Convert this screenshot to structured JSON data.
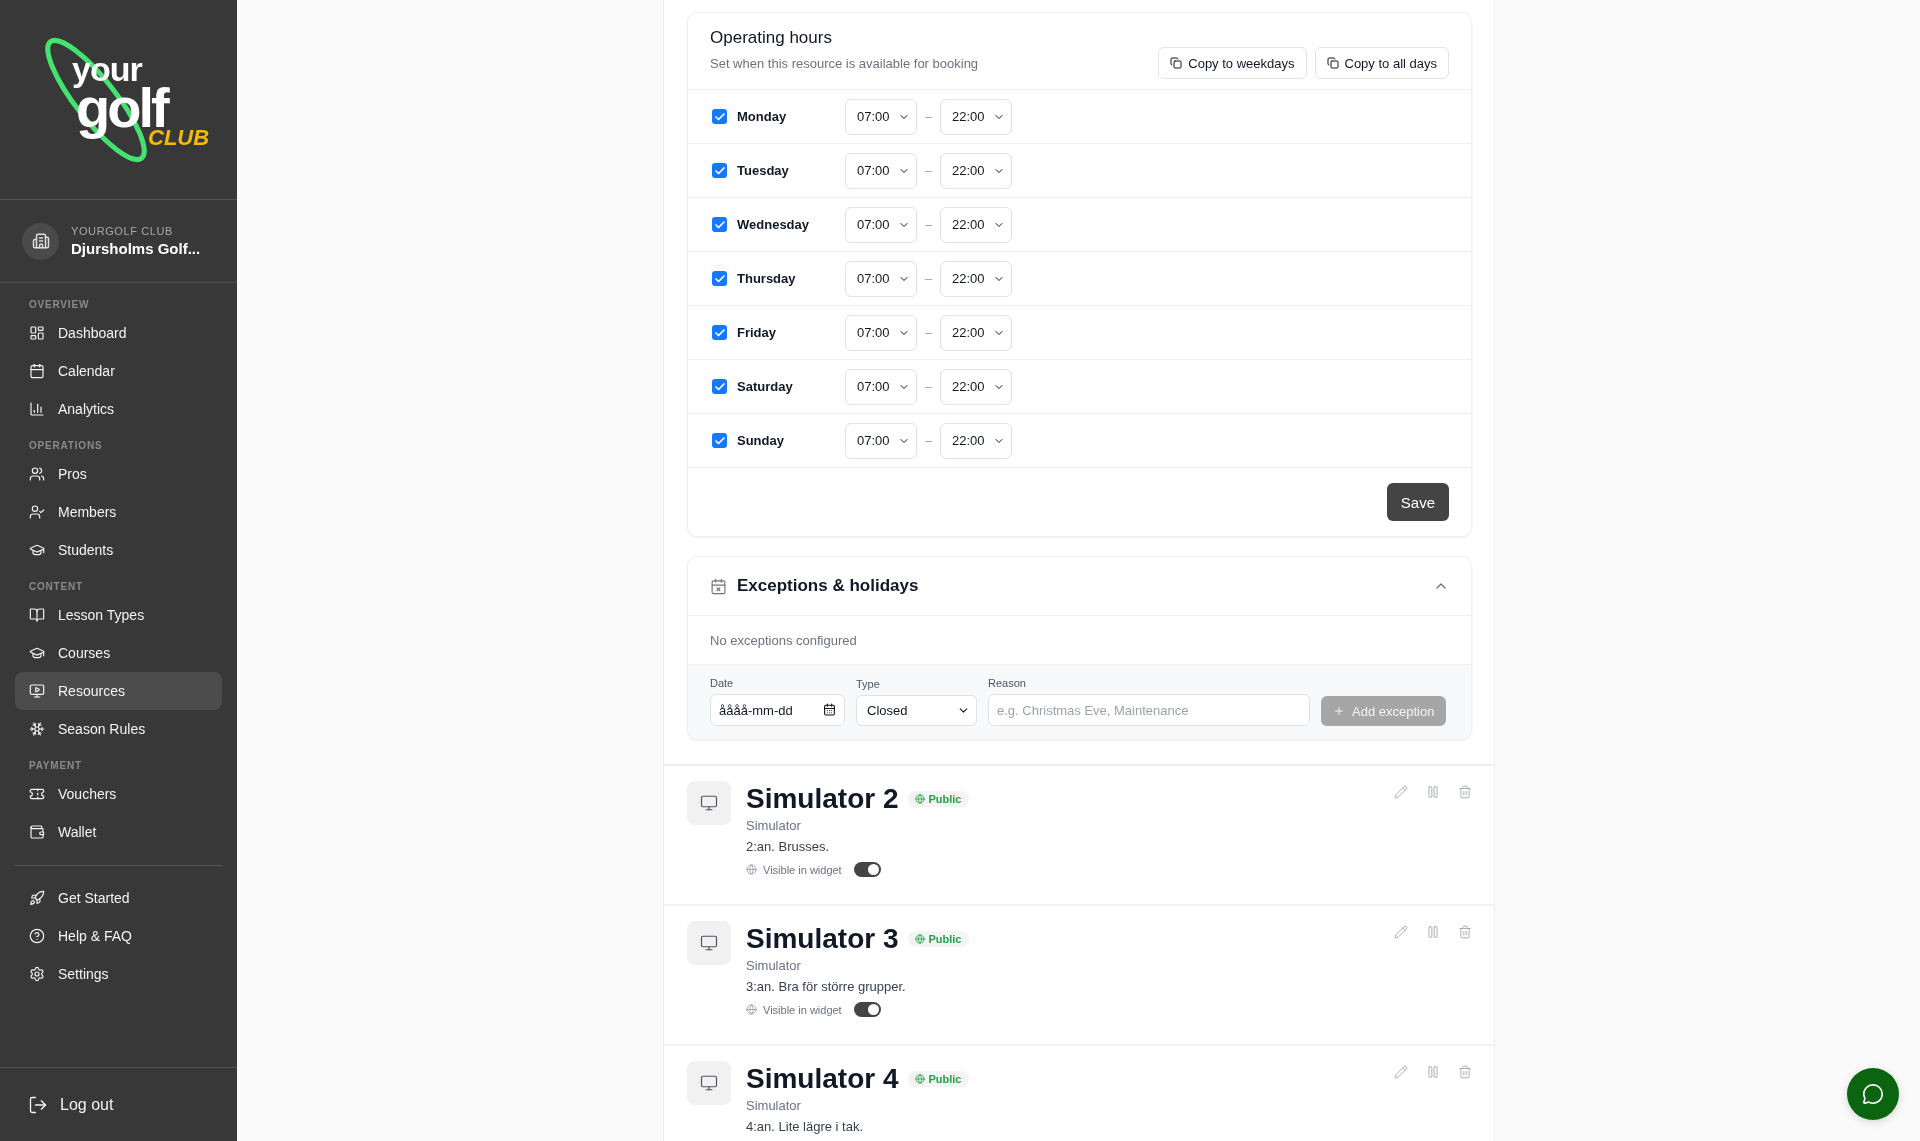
{
  "sidebar": {
    "logo": {
      "word_1": "your",
      "word_2": "golf",
      "word_3": "CLUB"
    },
    "club": {
      "label": "YOURGOLF CLUB",
      "name": "Djursholms Golf..."
    },
    "sections": [
      {
        "heading": "OVERVIEW",
        "items": [
          {
            "label": "Dashboard",
            "selected": false
          },
          {
            "label": "Calendar",
            "selected": false
          },
          {
            "label": "Analytics",
            "selected": false
          }
        ]
      },
      {
        "heading": "OPERATIONS",
        "items": [
          {
            "label": "Pros",
            "selected": false
          },
          {
            "label": "Members",
            "selected": false
          },
          {
            "label": "Students",
            "selected": false
          }
        ]
      },
      {
        "heading": "CONTENT",
        "items": [
          {
            "label": "Lesson Types",
            "selected": false
          },
          {
            "label": "Courses",
            "selected": false
          },
          {
            "label": "Resources",
            "selected": true
          },
          {
            "label": "Season Rules",
            "selected": false
          }
        ]
      },
      {
        "heading": "PAYMENT",
        "items": [
          {
            "label": "Vouchers",
            "selected": false
          },
          {
            "label": "Wallet",
            "selected": false
          }
        ]
      },
      {
        "items": [
          {
            "label": "Get Started",
            "selected": false
          },
          {
            "label": "Help & FAQ",
            "selected": false
          },
          {
            "label": "Settings",
            "selected": false
          }
        ]
      }
    ],
    "logout": "Log out"
  },
  "operating_hours": {
    "title": "Operating hours",
    "subtitle": "Set when this resource is available for booking",
    "buttons": [
      "Copy to weekdays",
      "Copy to all days"
    ],
    "days": [
      {
        "name": "Monday",
        "checked": true,
        "start": "07:00",
        "dash": "–",
        "end": "22:00"
      },
      {
        "name": "Tuesday",
        "checked": true,
        "start": "07:00",
        "dash": "–",
        "end": "22:00"
      },
      {
        "name": "Wednesday",
        "checked": true,
        "start": "07:00",
        "dash": "–",
        "end": "22:00"
      },
      {
        "name": "Thursday",
        "checked": true,
        "start": "07:00",
        "dash": "–",
        "end": "22:00"
      },
      {
        "name": "Friday",
        "checked": true,
        "start": "07:00",
        "dash": "–",
        "end": "22:00"
      },
      {
        "name": "Saturday",
        "checked": true,
        "start": "07:00",
        "dash": "–",
        "end": "22:00"
      },
      {
        "name": "Sunday",
        "checked": true,
        "start": "07:00",
        "dash": "–",
        "end": "22:00"
      }
    ],
    "save_button": "Save"
  },
  "exceptions": {
    "title": "Exceptions & holidays",
    "expanded": true,
    "empty_text": "No exceptions configured",
    "form": {
      "date": {
        "label": "Date",
        "placeholder": "åååå-mm-dd"
      },
      "type": {
        "label": "Type",
        "value": "Closed"
      },
      "reason": {
        "label": "Reason",
        "placeholder": "e.g. Christmas Eve, Maintenance"
      },
      "add_button": {
        "label": "Add exception",
        "disabled": true
      }
    }
  },
  "resources": [
    {
      "name": "Simulator 2",
      "badge": "Public",
      "type": "Simulator",
      "description": "2:an. Brusses.",
      "widget_label": "Visible in widget",
      "visible": true
    },
    {
      "name": "Simulator 3",
      "badge": "Public",
      "type": "Simulator",
      "description": "3:an. Bra för större grupper.",
      "widget_label": "Visible in widget",
      "visible": true
    },
    {
      "name": "Simulator 4",
      "badge": "Public",
      "type": "Simulator",
      "description": "4:an. Lite lägre i tak."
    }
  ]
}
